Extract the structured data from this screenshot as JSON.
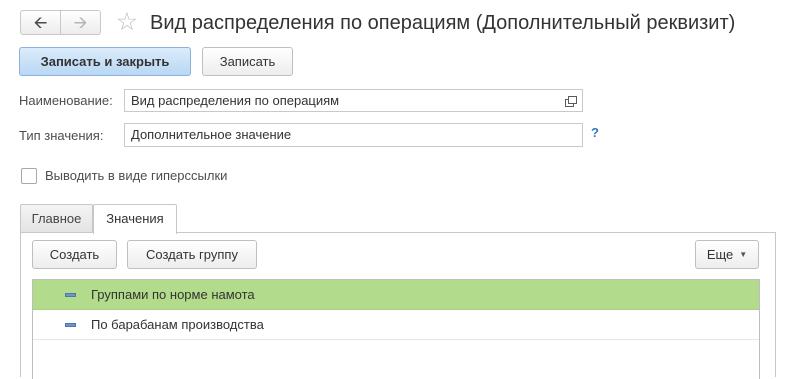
{
  "header": {
    "back_icon": "arrow-left-icon",
    "forward_icon": "arrow-right-icon",
    "favorite_icon": "star-icon",
    "title": "Вид распределения по операциям (Дополнительный реквизит)"
  },
  "toolbar": {
    "save_close_label": "Записать и закрыть",
    "save_label": "Записать"
  },
  "form": {
    "name_label": "Наименование:",
    "name_value": "Вид распределения по операциям",
    "type_label": "Тип значения:",
    "type_value": "Дополнительное значение",
    "help_label": "?",
    "hyperlink_label": "Выводить в виде гиперссылки",
    "hyperlink_checked": false
  },
  "tabs": [
    {
      "label": "Главное",
      "active": false
    },
    {
      "label": "Значения",
      "active": true
    }
  ],
  "values_toolbar": {
    "create_label": "Создать",
    "create_group_label": "Создать группу",
    "more_label": "Еще"
  },
  "list": {
    "items": [
      {
        "label": "Группами по норме намота",
        "selected": true
      },
      {
        "label": "По барабанам производства",
        "selected": false
      }
    ]
  },
  "colors": {
    "primary_button": "#b9d7f4",
    "selected_row": "#b2dc8b",
    "help_link": "#3b77c0"
  }
}
